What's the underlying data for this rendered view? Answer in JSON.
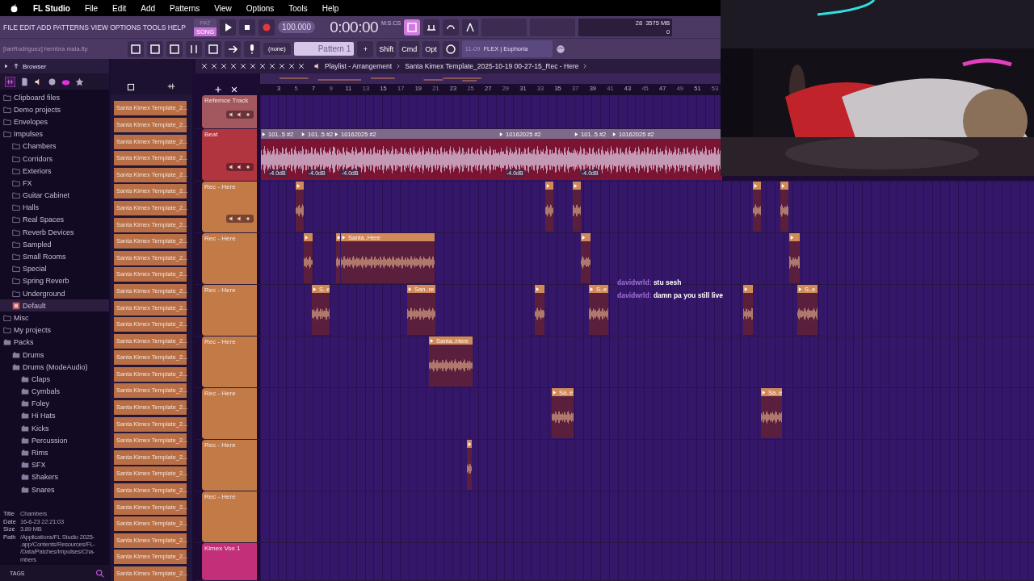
{
  "menu_bar": {
    "app": "FL Studio",
    "items": [
      "File",
      "Edit",
      "Add",
      "Patterns",
      "View",
      "Options",
      "Tools",
      "Help"
    ]
  },
  "toolbar": {
    "menu": [
      "FILE",
      "EDIT",
      "ADD",
      "PATTERNS",
      "VIEW",
      "OPTIONS",
      "TOOLS",
      "HELP"
    ],
    "modes": [
      {
        "label": "PAT",
        "selected": false
      },
      {
        "label": "SONG",
        "selected": true
      }
    ],
    "tempo": "100.000",
    "time": "0:00:00",
    "time_format": "M:S:CS",
    "cpu": "28",
    "memory": "3575 MB",
    "polyphony": "0",
    "project": "[IanRodriguez] hembra mala.flp",
    "pattern_picker": "(none)",
    "pattern": "Pattern 1",
    "add_pattern": "+",
    "keys": [
      "Shift",
      "Cmd",
      "Opt"
    ],
    "hint_date": "11-09",
    "hint": "FLEX | Euphoria"
  },
  "browser": {
    "title": "Browser",
    "items": [
      {
        "label": "Clipboard files",
        "kind": "folder",
        "selected": false
      },
      {
        "label": "Demo projects",
        "kind": "folder",
        "selected": false
      },
      {
        "label": "Envelopes",
        "kind": "folder",
        "selected": false
      },
      {
        "label": "Impulses",
        "kind": "folder",
        "selected": false,
        "children": [
          {
            "label": "Chambers",
            "kind": "folder",
            "selected": false
          },
          {
            "label": "Corridors",
            "kind": "folder",
            "selected": false
          },
          {
            "label": "Exteriors",
            "kind": "folder",
            "selected": false
          },
          {
            "label": "FX",
            "kind": "folder",
            "selected": false
          },
          {
            "label": "Guitar Cabinet",
            "kind": "folder",
            "selected": false
          },
          {
            "label": "Halls",
            "kind": "folder",
            "selected": false
          },
          {
            "label": "Real Spaces",
            "kind": "folder",
            "selected": false
          },
          {
            "label": "Reverb Devices",
            "kind": "folder",
            "selected": false
          },
          {
            "label": "Sampled",
            "kind": "folder",
            "selected": false
          },
          {
            "label": "Small Rooms",
            "kind": "folder",
            "selected": false
          },
          {
            "label": "Special",
            "kind": "folder",
            "selected": false
          },
          {
            "label": "Spring Reverb",
            "kind": "folder",
            "selected": false
          },
          {
            "label": "Underground",
            "kind": "folder",
            "selected": false
          },
          {
            "label": "Default",
            "kind": "preset",
            "selected": true
          }
        ]
      },
      {
        "label": "Misc",
        "kind": "folder",
        "selected": false
      },
      {
        "label": "My projects",
        "kind": "folder",
        "selected": false
      },
      {
        "label": "Packs",
        "kind": "pack",
        "selected": false,
        "children": [
          {
            "label": "Drums",
            "kind": "pack",
            "selected": false
          },
          {
            "label": "Drums (ModeAudio)",
            "kind": "pack",
            "selected": false,
            "children": [
              {
                "label": "Claps",
                "kind": "pack",
                "selected": false
              },
              {
                "label": "Cymbals",
                "kind": "pack",
                "selected": false
              },
              {
                "label": "Foley",
                "kind": "pack",
                "selected": false
              },
              {
                "label": "Hi Hats",
                "kind": "pack",
                "selected": false
              },
              {
                "label": "Kicks",
                "kind": "pack",
                "selected": false
              },
              {
                "label": "Percussion",
                "kind": "pack",
                "selected": false
              },
              {
                "label": "Rims",
                "kind": "pack",
                "selected": false
              },
              {
                "label": "SFX",
                "kind": "pack",
                "selected": false
              },
              {
                "label": "Shakers",
                "kind": "pack",
                "selected": false
              },
              {
                "label": "Snares",
                "kind": "pack",
                "selected": false
              }
            ]
          }
        ]
      }
    ],
    "info": [
      {
        "label": "Title",
        "value": [
          "Chambers"
        ]
      },
      {
        "label": "Date",
        "value": [
          "16-6-23 22:21:03"
        ]
      },
      {
        "label": "Size",
        "value": [
          "3.89 MB"
        ]
      },
      {
        "label": "Path",
        "value": [
          "/Applications/FL Studio 2025-",
          ".app/Contents/Resources/FL-",
          "/Data/Patches/Impulses/Cha-",
          "mbers"
        ]
      }
    ],
    "tags_label": "TAGS"
  },
  "patterns": [
    "Santa Kimex Template_2...",
    "Santa Kimex Template_2...",
    "Santa Kimex Template_2...",
    "Santa Kimex Template_2...",
    "Santa Kimex Template_2...",
    "Santa Kimex Template_2...",
    "Santa Kimex Template_2...",
    "Santa Kimex Template_2...",
    "Santa Kimex Template_2...",
    "Santa Kimex Template_2...",
    "Santa Kimex Template_2...",
    "Santa Kimex Template_2...",
    "Santa Kimex Template_2...",
    "Santa Kimex Template_2...",
    "Santa Kimex Template_2...",
    "Santa Kimex Template_2...",
    "Santa Kimex Template_2...",
    "Santa Kimex Template_2...",
    "Santa Kimex Template_2...",
    "Santa Kimex Template_2...",
    "Santa Kimex Template_2...",
    "Santa Kimex Template_2...",
    "Santa Kimex Template_2...",
    "Santa Kimex Template_2...",
    "Santa Kimex Template_2...",
    "Santa Kimex Template_2...",
    "Santa Kimex Template_2...",
    "Santa Kimex Template_2...",
    "Santa Kimex Template_2..."
  ],
  "playlist": {
    "title": "Playlist - Arrangement",
    "breadcrumb": "Santa Kimex Template_2025-10-19 00-27-15_Rec - Here",
    "ruler": [
      "3",
      "5",
      "7",
      "9",
      "11",
      "13",
      "15",
      "17",
      "19",
      "21",
      "23",
      "25",
      "27",
      "29",
      "31",
      "33",
      "35",
      "37",
      "39",
      "41",
      "43",
      "45",
      "47",
      "49",
      "51",
      "53"
    ],
    "tracks": [
      {
        "name": "Refernce Track",
        "color": "#a2585e",
        "controls": true
      },
      {
        "name": "Beat",
        "color": "#b0353f",
        "controls": true,
        "clips": [
          {
            "kind": "beat",
            "label": "101..5 #2",
            "gain": "-4.0dB"
          },
          {
            "kind": "beat",
            "label": "101..5 #2",
            "gain": "-4.0dB"
          },
          {
            "kind": "beat",
            "label": "10162025 #2",
            "gain": "-4.0dB"
          },
          {
            "kind": "beat",
            "label": "10162025 #2",
            "gain": "-4.0dB"
          },
          {
            "kind": "beat",
            "label": "101..5 #2",
            "gain": "-4.0dB"
          },
          {
            "kind": "beat",
            "label": "10162025 #2"
          }
        ]
      },
      {
        "name": "Rec - Here",
        "color": "#c27a47",
        "controls": true,
        "clips": [
          {
            "kind": "audio"
          },
          {
            "kind": "audio"
          },
          {
            "kind": "audio"
          },
          {
            "kind": "audio"
          },
          {
            "kind": "audio"
          }
        ]
      },
      {
        "name": "Rec - Here",
        "color": "#c27a47",
        "controls": false,
        "clips": [
          {
            "kind": "audio"
          },
          {
            "kind": "audio"
          },
          {
            "kind": "audio",
            "label": "Santa..Here"
          },
          {
            "kind": "audio"
          },
          {
            "kind": "audio"
          }
        ]
      },
      {
        "name": "Rec - Here",
        "color": "#c27a47",
        "controls": false,
        "clips": [
          {
            "kind": "audio",
            "label": "S..e"
          },
          {
            "kind": "audio",
            "label": "San..re"
          },
          {
            "kind": "audio"
          },
          {
            "kind": "audio",
            "label": "S..e"
          },
          {
            "kind": "audio"
          },
          {
            "kind": "audio",
            "label": "S..e"
          }
        ]
      },
      {
        "name": "Rec - Here",
        "color": "#c27a47",
        "controls": false,
        "clips": [
          {
            "kind": "audio",
            "label": "Santa..Here"
          }
        ]
      },
      {
        "name": "Rec - Here",
        "color": "#c27a47",
        "controls": false,
        "clips": [
          {
            "kind": "audio",
            "label": "Sa..e"
          },
          {
            "kind": "audio",
            "label": "Sa..e"
          }
        ]
      },
      {
        "name": "Rec - Here",
        "color": "#c27a47",
        "controls": false,
        "clips": [
          {
            "kind": "audio"
          }
        ]
      },
      {
        "name": "Rec - Here",
        "color": "#c27a47",
        "controls": false
      },
      {
        "name": "Kimex Vox 1",
        "color": "#c2307a",
        "controls": false
      }
    ]
  },
  "chat": [
    {
      "user": "davidwrld:",
      "text": "stu sesh"
    },
    {
      "user": "davidwrld:",
      "text": "damn pa you still live"
    }
  ]
}
